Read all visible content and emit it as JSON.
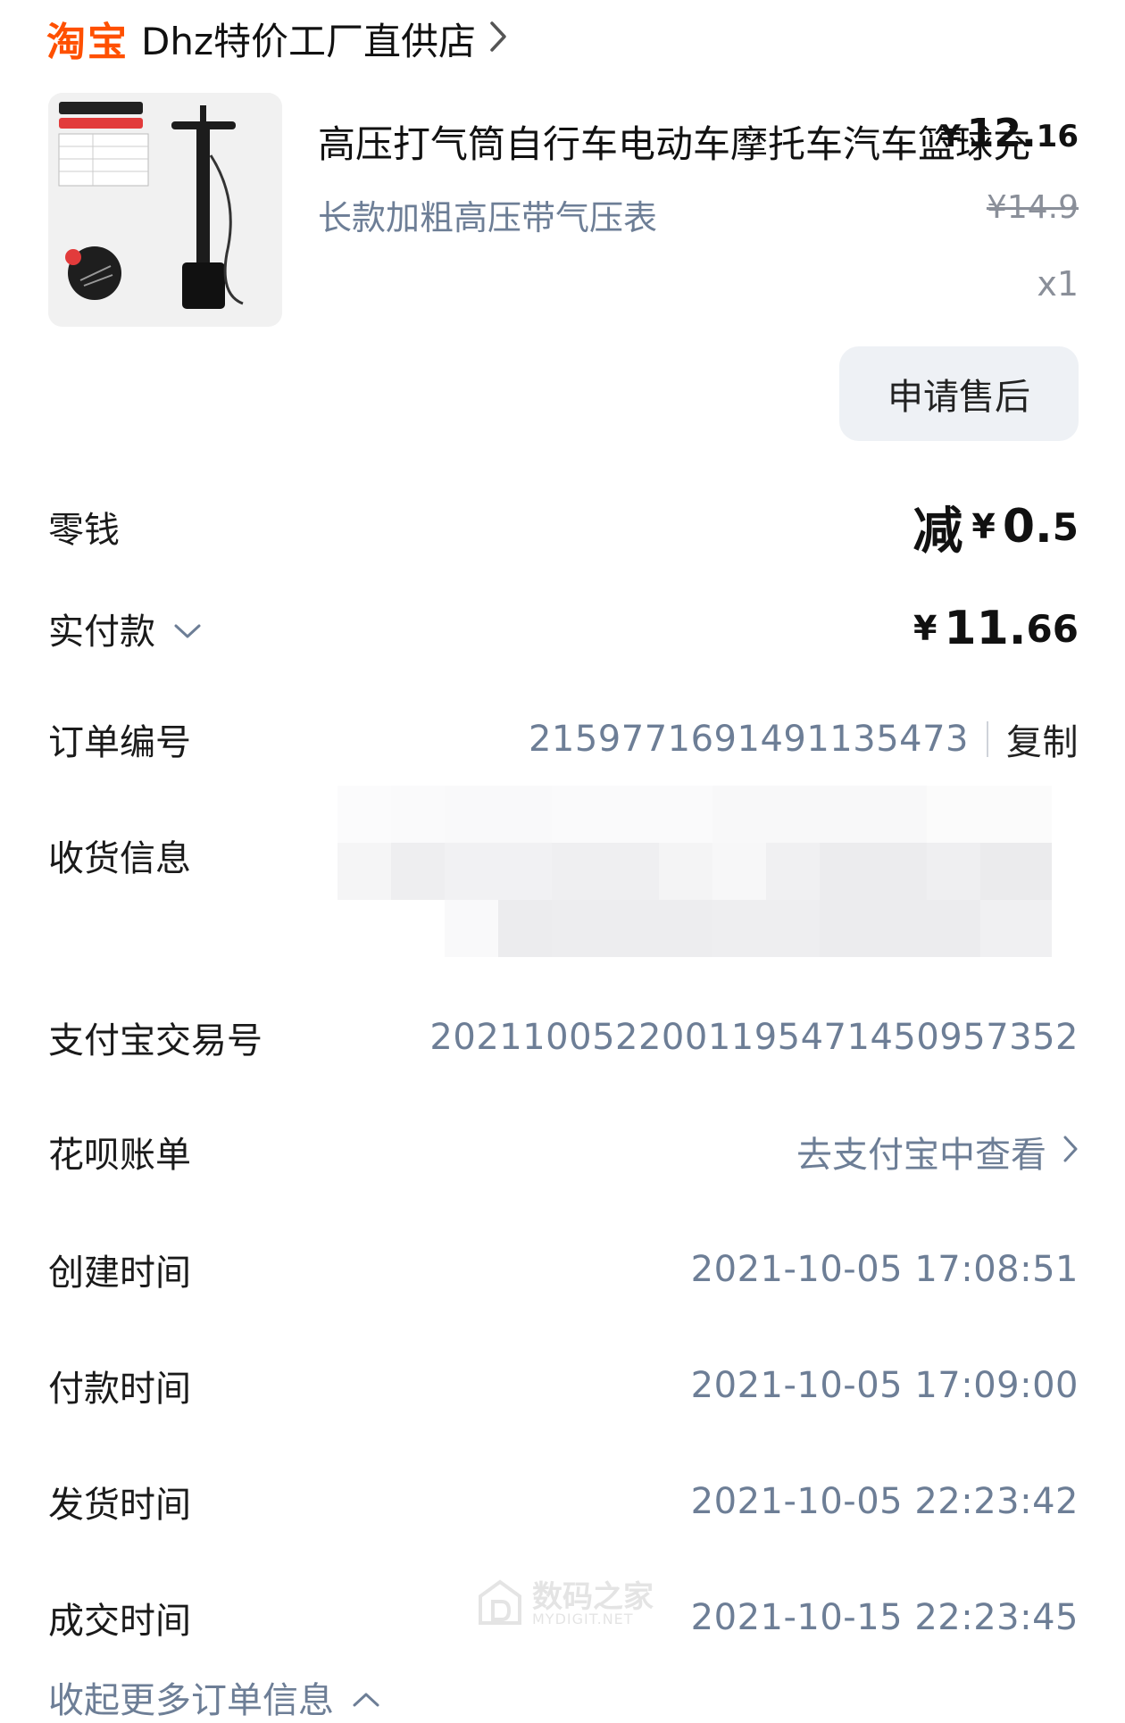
{
  "store": {
    "logo": "淘宝",
    "name": "Dhz特价工厂直供店"
  },
  "product": {
    "title": "高压打气筒自行车电动车摩托车汽车篮球充",
    "sku": "长款加粗高压带气压表",
    "price_yen": "¥",
    "price_int": "12.",
    "price_dec": "16",
    "original_price": "¥14.9",
    "quantity": "x1",
    "image_alt": "打气筒"
  },
  "aftersale_label": "申请售后",
  "rows": {
    "change": {
      "label": "零钱",
      "prefix": "减",
      "yen": "¥",
      "int": "0.",
      "dec": "5"
    },
    "paid": {
      "label": "实付款",
      "yen": "¥",
      "int": "11.",
      "dec": "66"
    },
    "order_no": {
      "label": "订单编号",
      "value": "2159771691491135473",
      "copy": "复制"
    },
    "address": {
      "label": "收货信息"
    },
    "alipay_no": {
      "label": "支付宝交易号",
      "value": "2021100522001195471450957352"
    },
    "huabei": {
      "label": "花呗账单",
      "value": "去支付宝中查看"
    },
    "created": {
      "label": "创建时间",
      "value": "2021-10-05 17:08:51"
    },
    "paid_time": {
      "label": "付款时间",
      "value": "2021-10-05 17:09:00"
    },
    "shipped": {
      "label": "发货时间",
      "value": "2021-10-05 22:23:42"
    },
    "completed": {
      "label": "成交时间",
      "value": "2021-10-15 22:23:45"
    }
  },
  "collapse_label": "收起更多订单信息",
  "watermark": {
    "cn": "数码之家",
    "en": "MYDIGIT.NET"
  },
  "colors": {
    "brand": "#ff5000",
    "muted": "#6d7e96",
    "button_bg": "#eef1f5"
  }
}
